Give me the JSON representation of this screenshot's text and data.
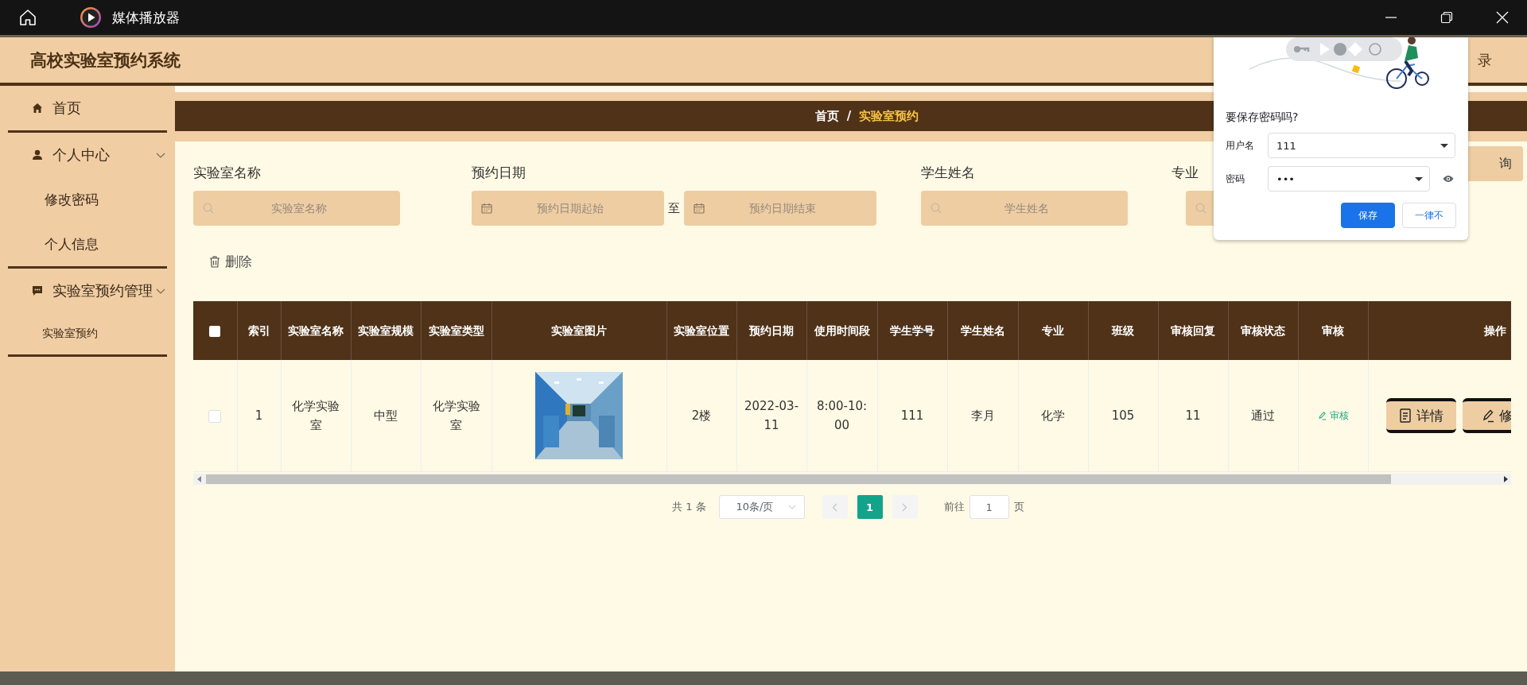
{
  "window": {
    "title": "媒体播放器"
  },
  "header": {
    "title": "高校实验室预约系统",
    "login": "录"
  },
  "sidebar": {
    "items": [
      {
        "label": "首页"
      },
      {
        "label": "个人中心",
        "expanded": true,
        "children": [
          {
            "label": "修改密码"
          },
          {
            "label": "个人信息"
          }
        ]
      },
      {
        "label": "实验室预约管理",
        "expanded": true,
        "children": [
          {
            "label": "实验室预约",
            "small": true
          }
        ]
      }
    ]
  },
  "breadcrumb": {
    "separator": "/",
    "items": [
      {
        "label": "首页",
        "current": false
      },
      {
        "label": "实验室预约",
        "current": true
      }
    ]
  },
  "filters": [
    {
      "kind": "text",
      "label": "实验室名称",
      "placeholder": "实验室名称"
    },
    {
      "kind": "daterange",
      "label": "预约日期",
      "start": {
        "placeholder": "预约日期起始"
      },
      "joiner": "至",
      "end": {
        "placeholder": "预约日期结束"
      }
    },
    {
      "kind": "text",
      "label": "学生姓名",
      "placeholder": "学生姓名"
    },
    {
      "kind": "text",
      "label": "专业"
    }
  ],
  "search_button": "询",
  "delete_button": "删除",
  "table": {
    "header_checkbox": {
      "checked": false
    },
    "columns": [
      "索引",
      "实验室名称",
      "实验室规模",
      "实验室类型",
      "实验室图片",
      "实验室位置",
      "预约日期",
      "使用时间段",
      "学生学号",
      "学生姓名",
      "专业",
      "班级",
      "审核回复",
      "审核状态",
      "审核",
      "操作"
    ],
    "rows": [
      {
        "selected": false,
        "cells": [
          {
            "kind": "text",
            "text": "1"
          },
          {
            "kind": "text",
            "text": "化学实验室"
          },
          {
            "kind": "text",
            "text": "中型"
          },
          {
            "kind": "text",
            "text": "化学实验室"
          },
          {
            "kind": "picture"
          },
          {
            "kind": "text",
            "text": "2楼"
          },
          {
            "kind": "text",
            "text": "2022-03-11"
          },
          {
            "kind": "text",
            "text": "8:00-10:00"
          },
          {
            "kind": "text",
            "text": "111"
          },
          {
            "kind": "text",
            "text": "李月"
          },
          {
            "kind": "text",
            "text": "化学"
          },
          {
            "kind": "text",
            "text": "105"
          },
          {
            "kind": "text",
            "text": "11"
          },
          {
            "kind": "text",
            "text": "通过"
          },
          {
            "kind": "link",
            "text": "审核"
          },
          {
            "kind": "actions",
            "buttons": [
              {
                "label": "详情"
              },
              {
                "label": "修"
              }
            ]
          }
        ]
      }
    ]
  },
  "pagination": {
    "total": "共 1 条",
    "page_size": "10条/页",
    "pages": [
      {
        "label": "1",
        "selected": true
      }
    ],
    "goto_label": "前往",
    "goto_value": "1",
    "page_suffix": "页"
  },
  "password_popup": {
    "title": "要保存密码吗?",
    "fields": [
      {
        "label": "用户名",
        "value": "111",
        "kind": "select"
      },
      {
        "label": "密码",
        "value": "•••",
        "kind": "password"
      }
    ],
    "buttons": [
      {
        "label": "保存",
        "primary": true
      },
      {
        "label": "一律不",
        "primary": false
      }
    ]
  }
}
